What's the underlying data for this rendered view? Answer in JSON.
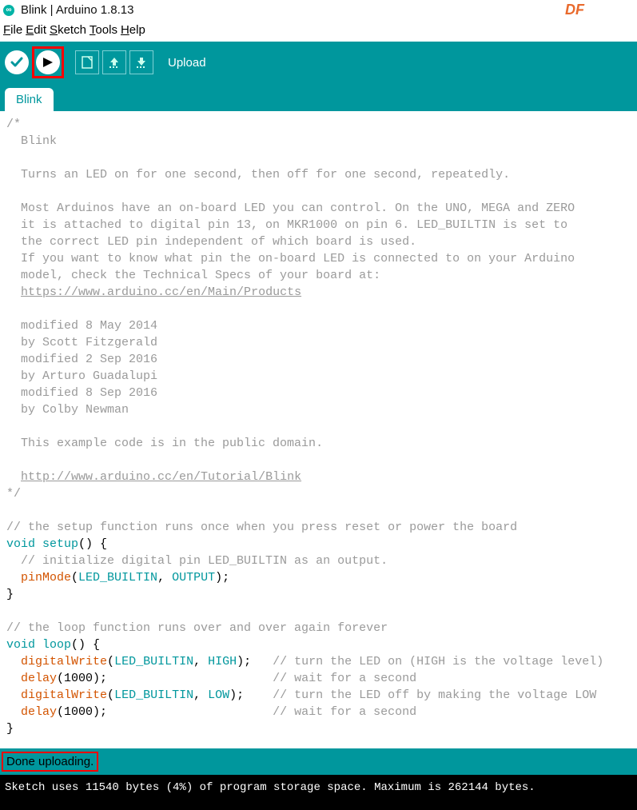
{
  "titlebar": {
    "title": "Blink | Arduino 1.8.13",
    "logo_text": "∞",
    "df": "DF"
  },
  "menubar": {
    "items": [
      {
        "letter": "F",
        "rest": "ile"
      },
      {
        "letter": "E",
        "rest": "dit"
      },
      {
        "letter": "S",
        "rest": "ketch"
      },
      {
        "letter": "T",
        "rest": "ools"
      },
      {
        "letter": "H",
        "rest": "elp"
      }
    ]
  },
  "toolbar": {
    "action_label": "Upload"
  },
  "tab": {
    "label": "Blink"
  },
  "code": {
    "L1": "/*",
    "L2": "  Blink",
    "L3": "",
    "L4": "  Turns an LED on for one second, then off for one second, repeatedly.",
    "L5": "",
    "L6": "  Most Arduinos have an on-board LED you can control. On the UNO, MEGA and ZERO",
    "L7": "  it is attached to digital pin 13, on MKR1000 on pin 6. LED_BUILTIN is set to",
    "L8": "  the correct LED pin independent of which board is used.",
    "L9": "  If you want to know what pin the on-board LED is connected to on your Arduino",
    "L10": "  model, check the Technical Specs of your board at:",
    "L11_pad": "  ",
    "L11_link": "https://www.arduino.cc/en/Main/Products",
    "L12": "",
    "L13": "  modified 8 May 2014",
    "L14": "  by Scott Fitzgerald",
    "L15": "  modified 2 Sep 2016",
    "L16": "  by Arturo Guadalupi",
    "L17": "  modified 8 Sep 2016",
    "L18": "  by Colby Newman",
    "L19": "",
    "L20": "  This example code is in the public domain.",
    "L21": "",
    "L22_pad": "  ",
    "L22_link": "http://www.arduino.cc/en/Tutorial/Blink",
    "L23": "*/",
    "L24": "",
    "L25_cm": "// the setup function runs once when you press reset or power the board",
    "L26_void": "void",
    "L26_setup": " setup",
    "L26_rest": "() {",
    "L27_cm": "  // initialize digital pin LED_BUILTIN as an output.",
    "L28_pad": "  ",
    "L28_pinmode": "pinMode",
    "L28_open": "(",
    "L28_led": "LED_BUILTIN",
    "L28_mid": ", ",
    "L28_out": "OUTPUT",
    "L28_end": ");",
    "L29": "}",
    "L30": "",
    "L31_cm": "// the loop function runs over and over again forever",
    "L32_void": "void",
    "L32_loop": " loop",
    "L32_rest": "() {",
    "L33_pad": "  ",
    "L33_dw": "digitalWrite",
    "L33_open": "(",
    "L33_led": "LED_BUILTIN",
    "L33_mid": ", ",
    "L33_high": "HIGH",
    "L33_end": ");   ",
    "L33_cm": "// turn the LED on (HIGH is the voltage level)",
    "L34_pad": "  ",
    "L34_delay": "delay",
    "L34_args": "(1000);                       ",
    "L34_cm": "// wait for a second",
    "L35_pad": "  ",
    "L35_dw": "digitalWrite",
    "L35_open": "(",
    "L35_led": "LED_BUILTIN",
    "L35_mid": ", ",
    "L35_low": "LOW",
    "L35_end": ");    ",
    "L35_cm": "// turn the LED off by making the voltage LOW",
    "L36_pad": "  ",
    "L36_delay": "delay",
    "L36_args": "(1000);                       ",
    "L36_cm": "// wait for a second",
    "L37": "}"
  },
  "status": {
    "text": "Done uploading."
  },
  "console": {
    "line1": "Sketch uses 11540 bytes (4%) of program storage space. Maximum is 262144 bytes."
  }
}
